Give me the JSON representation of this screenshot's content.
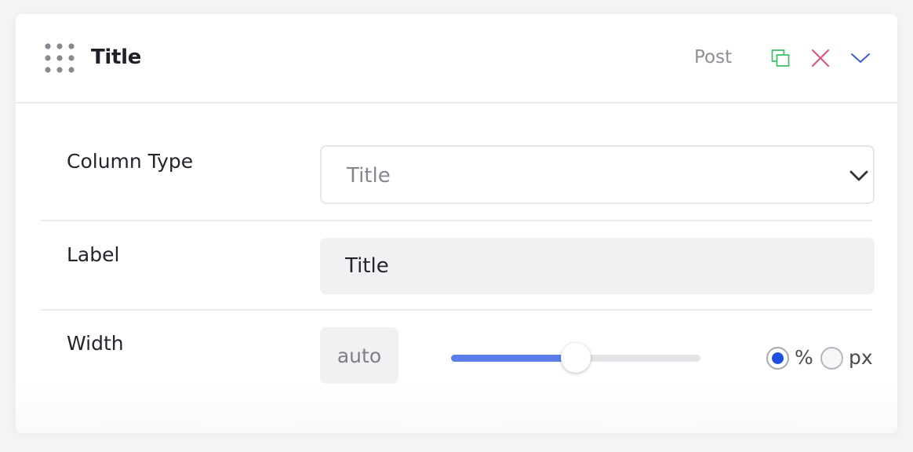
{
  "header": {
    "title": "Title",
    "post_type": "Post",
    "icons": [
      "drag-handle-icon",
      "duplicate-icon",
      "close-icon",
      "chevron-down-icon"
    ],
    "colors": {
      "duplicate": "#45c06a",
      "close": "#e0507a",
      "collapse": "#3a5fd0"
    }
  },
  "fields": {
    "column_type": {
      "label": "Column Type",
      "value": "Title"
    },
    "label": {
      "label": "Label",
      "value": "Title"
    },
    "width": {
      "label": "Width",
      "value": "auto",
      "slider_percent": 50,
      "units": [
        {
          "label": "%",
          "checked": true
        },
        {
          "label": "px",
          "checked": false
        }
      ]
    }
  },
  "colors": {
    "accent": "#1f4fe0",
    "slider_fill": "#5a7dea"
  }
}
